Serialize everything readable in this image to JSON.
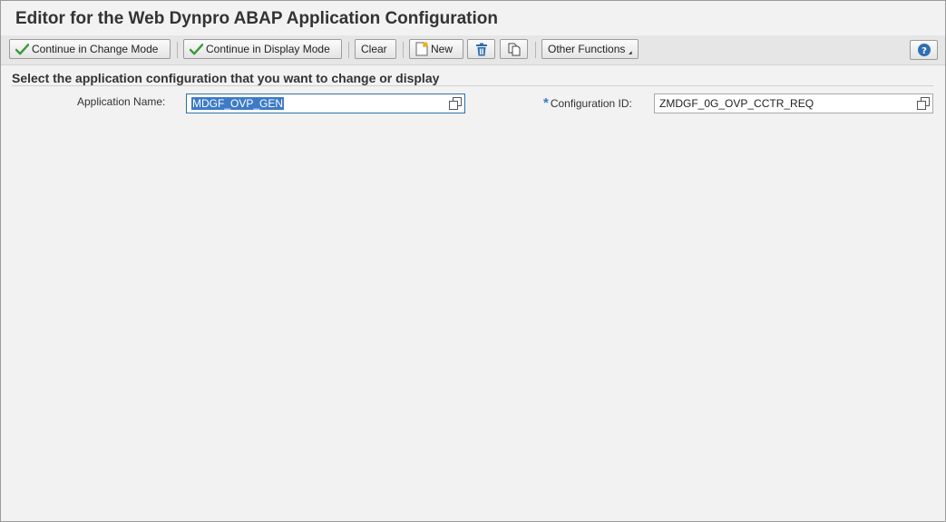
{
  "window": {
    "title": "Editor for the Web Dynpro ABAP Application Configuration"
  },
  "toolbar": {
    "change_mode_label": "Continue in Change Mode",
    "display_mode_label": "Continue in Display Mode",
    "clear_label": "Clear",
    "new_label": "New",
    "other_functions_label": "Other Functions"
  },
  "form": {
    "section_title": "Select the application configuration that you want to change or display",
    "app_name_label": "Application Name:",
    "app_name_value": "MDGF_OVP_GEN",
    "config_id_required_marker": "*",
    "config_id_label": "Configuration ID:",
    "config_id_value": "ZMDGF_0G_OVP_CCTR_REQ"
  },
  "colors": {
    "accent": "#2e7fcc",
    "check": "#3a9a3a",
    "selection": "#3d7bc6"
  },
  "icons": [
    "check-icon",
    "new-document-icon",
    "trash-icon",
    "copy-icon",
    "dropdown-arrow-icon",
    "help-icon",
    "value-help-icon"
  ]
}
